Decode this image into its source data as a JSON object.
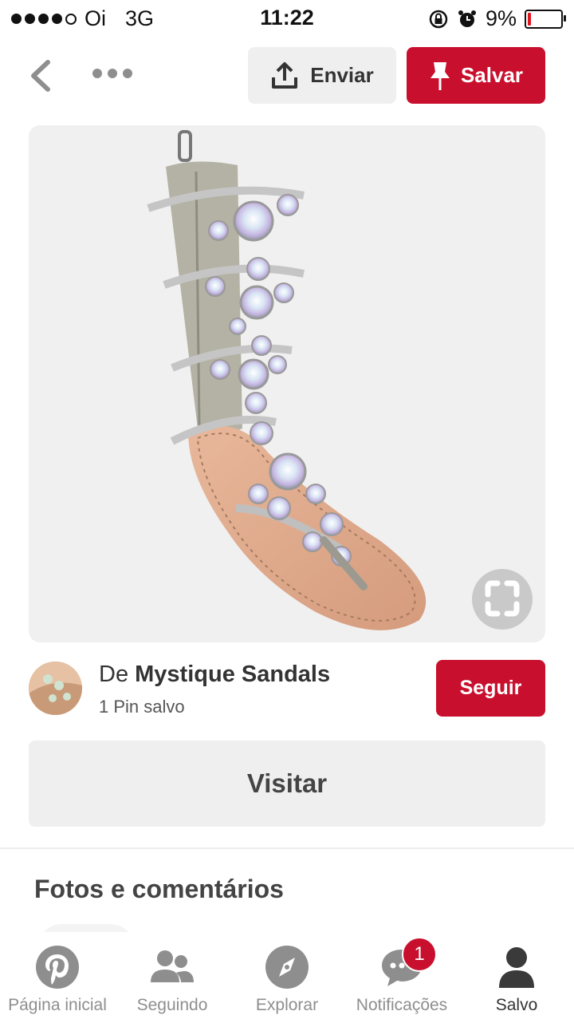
{
  "status_bar": {
    "carrier": "Oi",
    "network": "3G",
    "time": "11:22",
    "battery": "9%",
    "battery_level": 0.09
  },
  "nav": {
    "back_icon": "chevron-left-icon",
    "more_icon": "more-icon",
    "send_label": "Enviar",
    "save_label": "Salvar"
  },
  "pin": {
    "image_icon": "visual-search-icon"
  },
  "source": {
    "prefix": "De",
    "name": "Mystique Sandals",
    "pins": "1 Pin salvo",
    "follow_label": "Seguir"
  },
  "visit_label": "Visitar",
  "section_title": "Fotos e comentários",
  "tabs": [
    {
      "label": "Página inicial",
      "icon": "pinterest-icon"
    },
    {
      "label": "Seguindo",
      "icon": "people-icon"
    },
    {
      "label": "Explorar",
      "icon": "compass-icon"
    },
    {
      "label": "Notificações",
      "icon": "chat-icon",
      "badge": "1"
    },
    {
      "label": "Salvo",
      "icon": "profile-icon"
    }
  ],
  "colors": {
    "accent": "#c8102e",
    "button_gray": "#efefef"
  }
}
